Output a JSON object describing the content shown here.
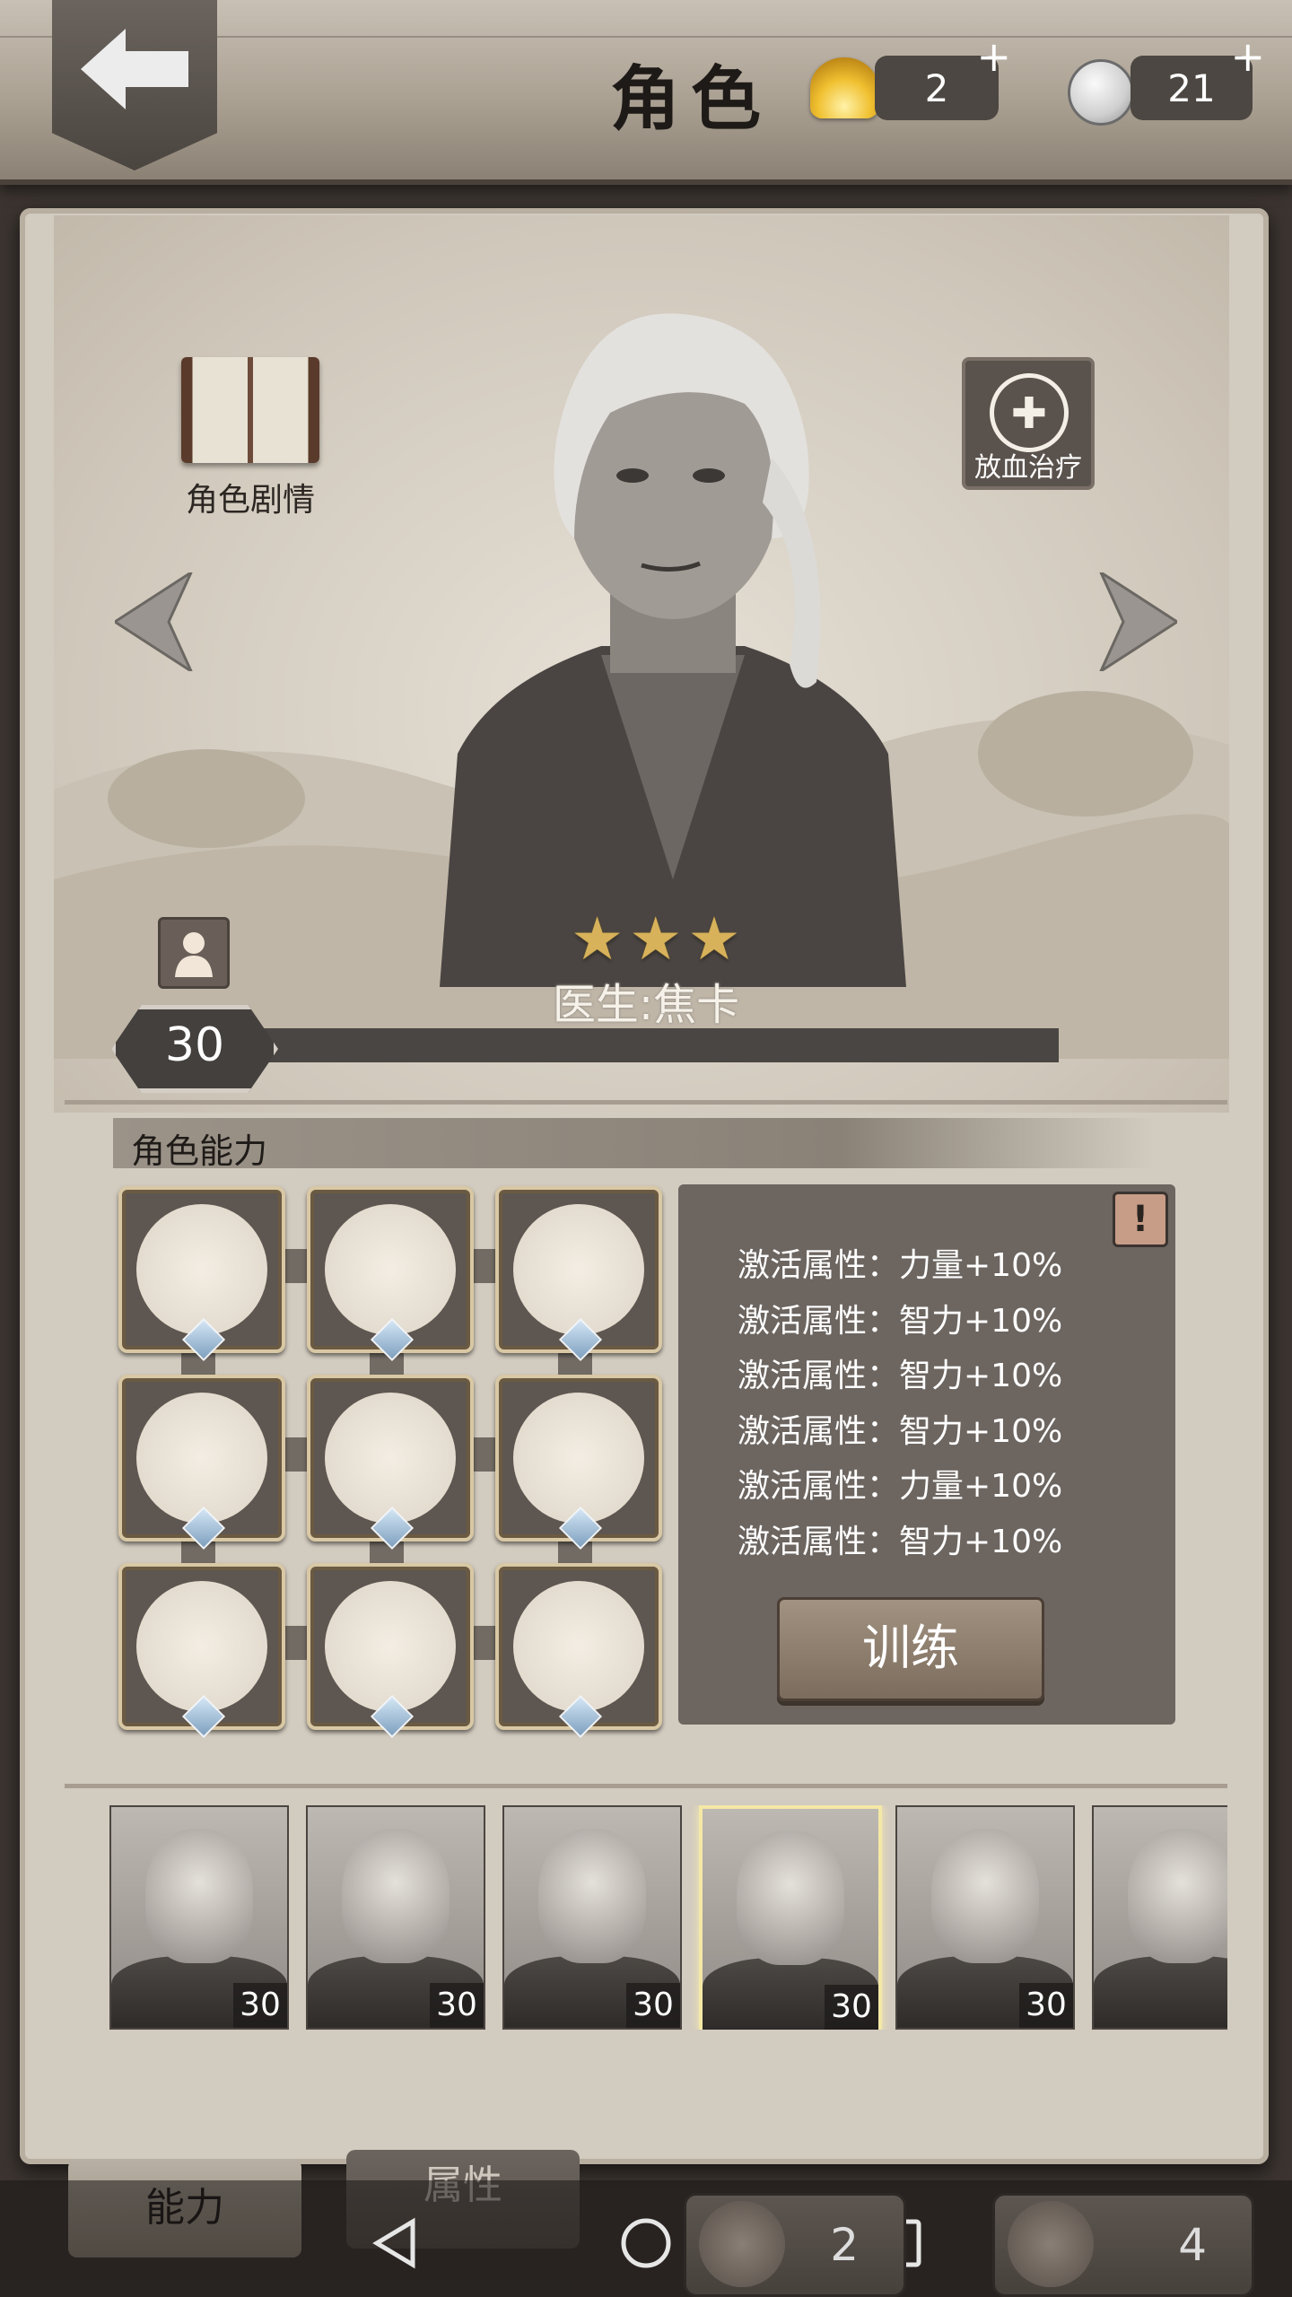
{
  "header": {
    "title": "角色",
    "shells": {
      "value": "2",
      "plus": "+"
    },
    "coins": {
      "value": "21",
      "plus": "+"
    }
  },
  "character": {
    "story_label": "角色剧情",
    "heal_label": "放血治疗",
    "heal_symbol": "✚",
    "name": "医生:焦卡",
    "stars": 3,
    "level": "30"
  },
  "abilities": {
    "section_title": "角色能力",
    "skills": [
      {
        "icon": "herb-icon"
      },
      {
        "icon": "cleaver-icon"
      },
      {
        "icon": "muscle-icon"
      },
      {
        "icon": "blood-drop-icon"
      },
      {
        "icon": "portrait-icon"
      },
      {
        "icon": "carry-box-icon"
      },
      {
        "icon": "magnifier-icon"
      },
      {
        "icon": "target-bear-icon"
      },
      {
        "icon": "no-guns-icon"
      }
    ],
    "info_warning": "!",
    "info_lines": [
      "激活属性：力量+10%",
      "激活属性：智力+10%",
      "激活属性：智力+10%",
      "激活属性：智力+10%",
      "激活属性：力量+10%",
      "激活属性：智力+10%"
    ],
    "train_label": "训练"
  },
  "roster": [
    {
      "level": "30"
    },
    {
      "level": "30"
    },
    {
      "level": "30"
    },
    {
      "level": "30",
      "selected": true
    },
    {
      "level": "30"
    },
    {
      "level": ""
    }
  ],
  "bottom_tabs": {
    "ability": "能力",
    "attributes": "属性"
  },
  "resources": {
    "left": "2",
    "right": "4"
  },
  "colors": {
    "panel": "#d2cbbf",
    "header_wood": "#a89e90",
    "level_bar": "#4a4643",
    "info_box": "#6c6560",
    "selected_border": "#f4e8a6"
  }
}
